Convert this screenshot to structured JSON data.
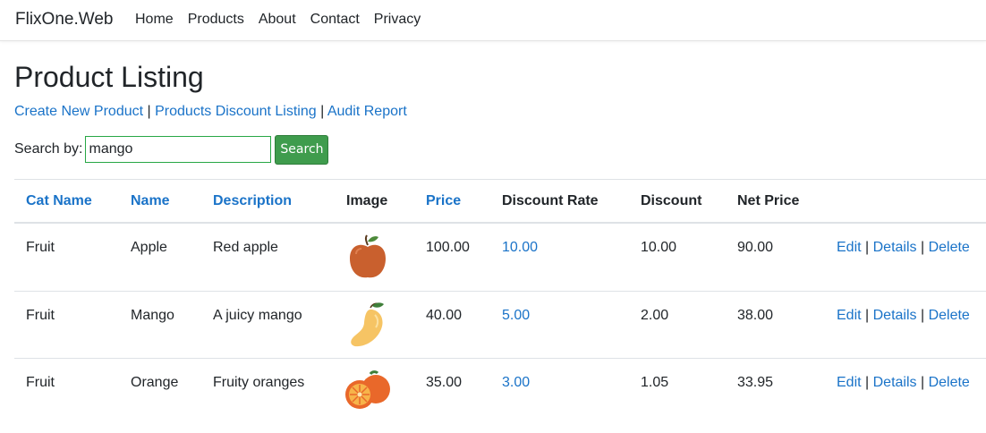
{
  "nav": {
    "brand": "FlixOne.Web",
    "links": [
      "Home",
      "Products",
      "About",
      "Contact",
      "Privacy"
    ]
  },
  "page": {
    "title": "Product Listing",
    "links": [
      "Create New Product",
      "Products Discount Listing",
      "Audit Report"
    ],
    "separator": "|"
  },
  "search": {
    "label": "Search by:",
    "value": "mango",
    "button": "Search"
  },
  "table": {
    "headers": [
      "Cat Name",
      "Name",
      "Description",
      "Image",
      "Price",
      "Discount Rate",
      "Discount",
      "Net Price"
    ],
    "rows": [
      {
        "cat": "Fruit",
        "name": "Apple",
        "description": "Red apple",
        "image": "apple-icon",
        "price": "100.00",
        "discount_rate": "10.00",
        "discount": "10.00",
        "net_price": "90.00"
      },
      {
        "cat": "Fruit",
        "name": "Mango",
        "description": "A juicy mango",
        "image": "mango-icon",
        "price": "40.00",
        "discount_rate": "5.00",
        "discount": "2.00",
        "net_price": "38.00"
      },
      {
        "cat": "Fruit",
        "name": "Orange",
        "description": "Fruity oranges",
        "image": "orange-icon",
        "price": "35.00",
        "discount_rate": "3.00",
        "discount": "1.05",
        "net_price": "33.95"
      }
    ],
    "actions": [
      "Edit",
      "Details",
      "Delete"
    ]
  },
  "colors": {
    "link": "#1a73c8",
    "search_button": "#3f9c4d",
    "apple": "#c9602e",
    "mango": "#f6c464",
    "orange": "#e9682a"
  }
}
